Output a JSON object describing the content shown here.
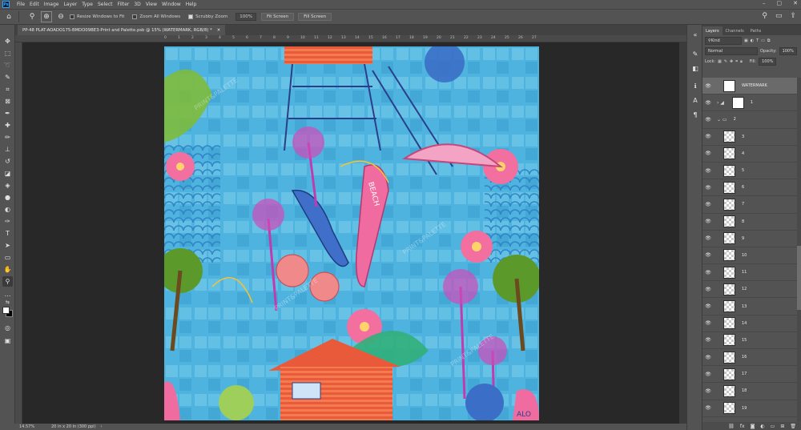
{
  "menu": [
    "File",
    "Edit",
    "Image",
    "Layer",
    "Type",
    "Select",
    "Filter",
    "3D",
    "View",
    "Window",
    "Help"
  ],
  "window_controls": [
    "–",
    "▢",
    "✕"
  ],
  "options": {
    "resize_windows": "Resize Windows to Fit",
    "zoom_all": "Zoom All Windows",
    "scrubby_zoom": "Scrubby Zoom",
    "zoom_value": "100%",
    "fit_screen": "Fit Screen",
    "fill_screen": "Fill Screen"
  },
  "document_tab": {
    "title": "PP-48 PLAT-AOADO175-BMDO09BE3-Print and Palette.psb @ 15% (WATERMARK, RGB/8) *",
    "close": "✕"
  },
  "ruler_ticks": [
    "0",
    "1",
    "2",
    "3",
    "4",
    "5",
    "6",
    "7",
    "8",
    "9",
    "10",
    "11",
    "12",
    "13",
    "14",
    "15",
    "16",
    "17",
    "18",
    "19",
    "20",
    "21",
    "22",
    "23",
    "24",
    "25",
    "26",
    "27"
  ],
  "status": {
    "zoom": "14.57%",
    "doc_size": "20 in x 20 in (300 ppi)"
  },
  "panel": {
    "tabs": [
      "Layers",
      "Channels",
      "Paths"
    ],
    "filter_kind": "Kind",
    "blend_mode": "Normal",
    "opacity_label": "Opacity:",
    "opacity_value": "100%",
    "lock_label": "Lock:",
    "fill_label": "Fill:",
    "fill_value": "100%"
  },
  "layers": [
    {
      "name": "WATERMARK",
      "kind": "watermark"
    },
    {
      "name": "1",
      "kind": "group"
    },
    {
      "name": "2",
      "kind": "folder"
    },
    {
      "name": "3",
      "kind": "pixel"
    },
    {
      "name": "4",
      "kind": "pixel"
    },
    {
      "name": "5",
      "kind": "pixel"
    },
    {
      "name": "6",
      "kind": "pixel"
    },
    {
      "name": "7",
      "kind": "pixel"
    },
    {
      "name": "8",
      "kind": "pixel"
    },
    {
      "name": "9",
      "kind": "pixel"
    },
    {
      "name": "10",
      "kind": "pixel"
    },
    {
      "name": "11",
      "kind": "pixel"
    },
    {
      "name": "12",
      "kind": "pixel"
    },
    {
      "name": "13",
      "kind": "pixel"
    },
    {
      "name": "14",
      "kind": "pixel"
    },
    {
      "name": "15",
      "kind": "pixel"
    },
    {
      "name": "16",
      "kind": "pixel"
    },
    {
      "name": "17",
      "kind": "pixel"
    },
    {
      "name": "18",
      "kind": "pixel"
    },
    {
      "name": "19",
      "kind": "pixel"
    }
  ],
  "artwork": {
    "watermark": "PRINT&PALETTE",
    "surf_text": "BEACH",
    "corner_text": "ALO"
  }
}
